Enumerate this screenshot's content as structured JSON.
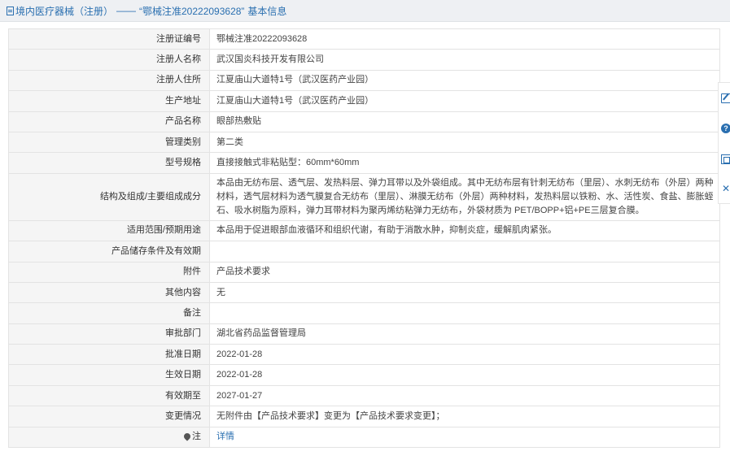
{
  "header": {
    "category": "境内医疗器械（注册）",
    "separator": "——",
    "cert_quoted": "“鄂械注准20222093628”",
    "suffix": "基本信息"
  },
  "rows": [
    {
      "label": "注册证编号",
      "value": "鄂械注准20222093628"
    },
    {
      "label": "注册人名称",
      "value": "武汉国炎科技开发有限公司"
    },
    {
      "label": "注册人住所",
      "value": "江夏庙山大道特1号（武汉医药产业园）"
    },
    {
      "label": "生产地址",
      "value": "江夏庙山大道特1号（武汉医药产业园）"
    },
    {
      "label": "产品名称",
      "value": "眼部热敷贴"
    },
    {
      "label": "管理类别",
      "value": "第二类"
    },
    {
      "label": "型号规格",
      "value": "直接接触式非粘贴型：60mm*60mm"
    },
    {
      "label": "结构及组成/主要组成成分",
      "value": "本品由无纺布层、透气层、发热料层、弹力耳带以及外袋组成。其中无纺布层有针刺无纺布（里层）、水刺无纺布（外层）两种材料，透气层材料为透气膜复合无纺布（里层）、淋膜无纺布（外层）两种材料，发热料层以铁粉、水、活性炭、食盐、膨胀蛭石、吸水树脂为原料，弹力耳带材料为聚丙烯纺粘弹力无纺布，外袋材质为 PET/BOPP+铝+PE三层复合膜。"
    },
    {
      "label": "适用范围/预期用途",
      "value": "本品用于促进眼部血液循环和组织代谢，有助于消散水肿，抑制炎症，缓解肌肉紧张。"
    },
    {
      "label": "产品储存条件及有效期",
      "value": ""
    },
    {
      "label": "附件",
      "value": "产品技术要求"
    },
    {
      "label": "其他内容",
      "value": "无"
    },
    {
      "label": "备注",
      "value": ""
    },
    {
      "label": "审批部门",
      "value": "湖北省药品监督管理局"
    },
    {
      "label": "批准日期",
      "value": "2022-01-28"
    },
    {
      "label": "生效日期",
      "value": "2022-01-28"
    },
    {
      "label": "有效期至",
      "value": "2027-01-27"
    },
    {
      "label": "变更情况",
      "value": "无附件由【产品技术要求】变更为【产品技术要求变更】；"
    }
  ],
  "note_row": {
    "label": "注",
    "link_text": "详情",
    "icon": "location-pin-icon"
  },
  "sidebar": {
    "icons": [
      "edit-icon",
      "help-icon",
      "copy-icon",
      "close-icon"
    ],
    "help_glyph": "?",
    "close_glyph": "✕"
  },
  "colors": {
    "accent": "#2a6fb0",
    "label_bg": "#f5f5f5",
    "header_bg": "#eef0f3"
  }
}
